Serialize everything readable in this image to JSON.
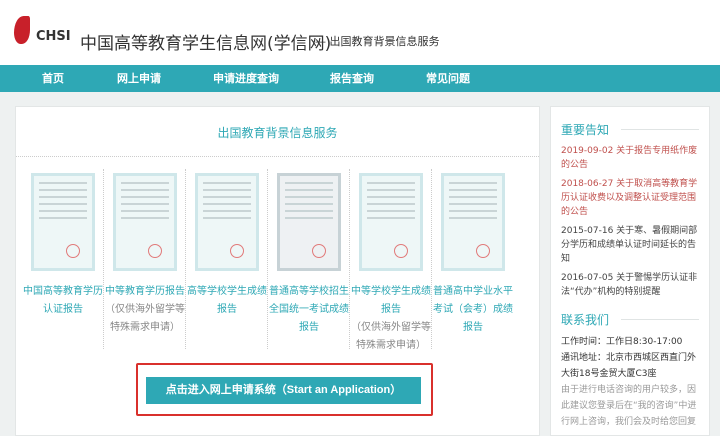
{
  "header": {
    "logo_text": "CHSI",
    "title": "中国高等教育学生信息网(学信网)",
    "subtitle": "— 出国教育背景信息服务"
  },
  "nav": [
    "首页",
    "网上申请",
    "申请进度查询",
    "报告查询",
    "常见问题"
  ],
  "main": {
    "title": "出国教育背景信息服务",
    "cards": [
      {
        "label": "中国高等教育学历认证报告",
        "note": ""
      },
      {
        "label": "中等教育学历报告",
        "note": "（仅供海外留学等特殊需求申请）"
      },
      {
        "label": "高等学校学生成绩报告",
        "note": ""
      },
      {
        "label": "普通高等学校招生全国统一考试成绩报告",
        "note": ""
      },
      {
        "label": "中等学校学生成绩报告",
        "note": "（仅供海外留学等特殊需求申请）"
      },
      {
        "label": "普通高中学业水平考试（会考）成绩报告",
        "note": ""
      }
    ],
    "apply_button": "点击进入网上申请系统（Start an Application）"
  },
  "sidebar": {
    "notices_title": "重要告知",
    "notices": [
      {
        "text": "2019-09-02 关于报告专用纸作废的公告",
        "color": "#c0504d"
      },
      {
        "text": "2018-06-27 关于取消高等教育学历认证收费以及调整认证受理范围的公告",
        "color": "#c0504d"
      },
      {
        "text": "2015-07-16 关于寒、暑假期间部分学历和成绩单认证时间延长的告知",
        "color": "#444444"
      },
      {
        "text": "2016-07-05 关于警惕学历认证非法“代办”机构的特别提醒",
        "color": "#444444"
      }
    ],
    "contact_title": "联系我们",
    "hours": "工作时间：工作日8:30-17:00",
    "address": "通讯地址：北京市西城区西直门外大街18号金贸大厦C3座",
    "hint": "由于进行电话咨询的用户较多，因此建议您登录后在“我的咨询”中进行网上咨询，我们会及时给您回复"
  },
  "colors": {
    "accent": "#2ea8b5",
    "highlight": "#d9302c"
  }
}
